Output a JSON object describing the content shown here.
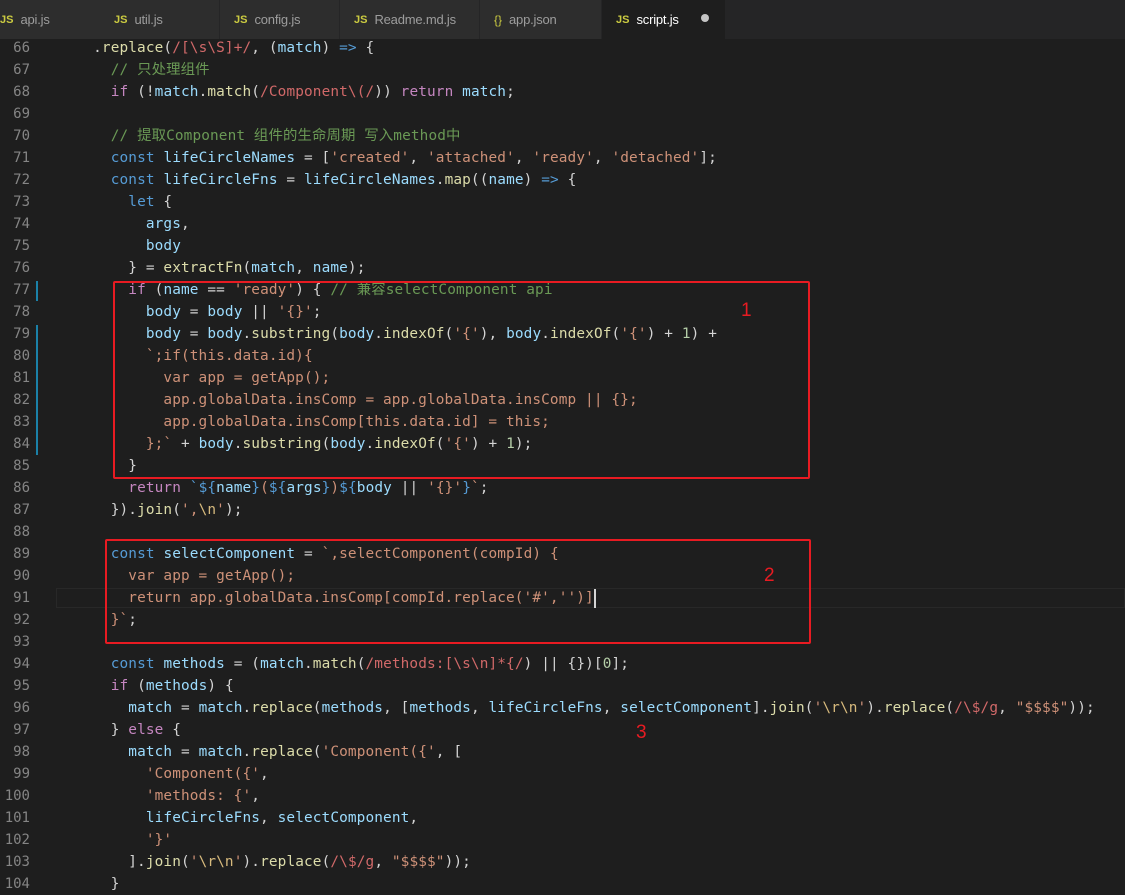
{
  "tabs": [
    {
      "icon": "JS",
      "label": "api.js",
      "active": false
    },
    {
      "icon": "JS",
      "label": "util.js",
      "active": false
    },
    {
      "icon": "JS",
      "label": "config.js",
      "active": false
    },
    {
      "icon": "JS",
      "label": "Readme.md.js",
      "active": false
    },
    {
      "icon": "{}",
      "label": "app.json",
      "active": false
    },
    {
      "icon": "JS",
      "label": "script.js",
      "active": true,
      "dirty": true
    }
  ],
  "lines": [
    {
      "n": "66"
    },
    {
      "n": "67"
    },
    {
      "n": "68"
    },
    {
      "n": "69"
    },
    {
      "n": "70"
    },
    {
      "n": "71"
    },
    {
      "n": "72"
    },
    {
      "n": "73"
    },
    {
      "n": "74"
    },
    {
      "n": "75"
    },
    {
      "n": "76"
    },
    {
      "n": "77"
    },
    {
      "n": "78"
    },
    {
      "n": "79"
    },
    {
      "n": "80"
    },
    {
      "n": "81"
    },
    {
      "n": "82"
    },
    {
      "n": "83"
    },
    {
      "n": "84"
    },
    {
      "n": "85"
    },
    {
      "n": "86"
    },
    {
      "n": "87"
    },
    {
      "n": "88"
    },
    {
      "n": "89"
    },
    {
      "n": "90"
    },
    {
      "n": "91"
    },
    {
      "n": "92"
    },
    {
      "n": "93"
    },
    {
      "n": "94"
    },
    {
      "n": "95"
    },
    {
      "n": "96"
    },
    {
      "n": "97"
    },
    {
      "n": "98"
    },
    {
      "n": "99"
    },
    {
      "n": "100"
    },
    {
      "n": "101"
    },
    {
      "n": "102"
    },
    {
      "n": "103"
    },
    {
      "n": "104"
    }
  ],
  "code": [
    [
      [
        "    .",
        "p"
      ],
      [
        "replace",
        "fn"
      ],
      [
        "(",
        "p"
      ],
      [
        "/[\\s\\S]+/",
        "rx"
      ],
      [
        ", (",
        "p"
      ],
      [
        "match",
        "var"
      ],
      [
        ") ",
        "p"
      ],
      [
        "=>",
        "kw"
      ],
      [
        " {",
        "p"
      ]
    ],
    [
      [
        "      ",
        "p"
      ],
      [
        "// 只处理组件",
        "com"
      ]
    ],
    [
      [
        "      ",
        "p"
      ],
      [
        "if",
        "ctl"
      ],
      [
        " (!",
        "p"
      ],
      [
        "match",
        "var"
      ],
      [
        ".",
        "p"
      ],
      [
        "match",
        "fn"
      ],
      [
        "(",
        "p"
      ],
      [
        "/Component\\(/",
        "rx"
      ],
      [
        ")) ",
        "p"
      ],
      [
        "return",
        "ctl"
      ],
      [
        " ",
        "p"
      ],
      [
        "match",
        "var"
      ],
      [
        ";",
        "p"
      ]
    ],
    [
      [
        "",
        "p"
      ]
    ],
    [
      [
        "      ",
        "p"
      ],
      [
        "// 提取Component 组件的生命周期 写入method中",
        "com"
      ]
    ],
    [
      [
        "      ",
        "p"
      ],
      [
        "const",
        "kw"
      ],
      [
        " ",
        "p"
      ],
      [
        "lifeCircleNames",
        "var"
      ],
      [
        " = [",
        "p"
      ],
      [
        "'created'",
        "str"
      ],
      [
        ", ",
        "p"
      ],
      [
        "'attached'",
        "str"
      ],
      [
        ", ",
        "p"
      ],
      [
        "'ready'",
        "str"
      ],
      [
        ", ",
        "p"
      ],
      [
        "'detached'",
        "str"
      ],
      [
        "];",
        "p"
      ]
    ],
    [
      [
        "      ",
        "p"
      ],
      [
        "const",
        "kw"
      ],
      [
        " ",
        "p"
      ],
      [
        "lifeCircleFns",
        "var"
      ],
      [
        " = ",
        "p"
      ],
      [
        "lifeCircleNames",
        "var"
      ],
      [
        ".",
        "p"
      ],
      [
        "map",
        "fn"
      ],
      [
        "((",
        "p"
      ],
      [
        "name",
        "var"
      ],
      [
        ") ",
        "p"
      ],
      [
        "=>",
        "kw"
      ],
      [
        " {",
        "p"
      ]
    ],
    [
      [
        "        ",
        "p"
      ],
      [
        "let",
        "kw"
      ],
      [
        " {",
        "p"
      ]
    ],
    [
      [
        "          ",
        "p"
      ],
      [
        "args",
        "var"
      ],
      [
        ",",
        "p"
      ]
    ],
    [
      [
        "          ",
        "p"
      ],
      [
        "body",
        "var"
      ]
    ],
    [
      [
        "        } = ",
        "p"
      ],
      [
        "extractFn",
        "fn"
      ],
      [
        "(",
        "p"
      ],
      [
        "match",
        "var"
      ],
      [
        ", ",
        "p"
      ],
      [
        "name",
        "var"
      ],
      [
        ");",
        "p"
      ]
    ],
    [
      [
        "        ",
        "p"
      ],
      [
        "if",
        "ctl"
      ],
      [
        " (",
        "p"
      ],
      [
        "name",
        "var"
      ],
      [
        " == ",
        "p"
      ],
      [
        "'ready'",
        "str"
      ],
      [
        ") { ",
        "p"
      ],
      [
        "// 兼容selectComponent api",
        "com"
      ]
    ],
    [
      [
        "          ",
        "p"
      ],
      [
        "body",
        "var"
      ],
      [
        " = ",
        "p"
      ],
      [
        "body",
        "var"
      ],
      [
        " || ",
        "p"
      ],
      [
        "'{}'",
        "str"
      ],
      [
        ";",
        "p"
      ]
    ],
    [
      [
        "          ",
        "p"
      ],
      [
        "body",
        "var"
      ],
      [
        " = ",
        "p"
      ],
      [
        "body",
        "var"
      ],
      [
        ".",
        "p"
      ],
      [
        "substring",
        "fn"
      ],
      [
        "(",
        "p"
      ],
      [
        "body",
        "var"
      ],
      [
        ".",
        "p"
      ],
      [
        "indexOf",
        "fn"
      ],
      [
        "(",
        "p"
      ],
      [
        "'{'",
        "str"
      ],
      [
        "), ",
        "p"
      ],
      [
        "body",
        "var"
      ],
      [
        ".",
        "p"
      ],
      [
        "indexOf",
        "fn"
      ],
      [
        "(",
        "p"
      ],
      [
        "'{'",
        "str"
      ],
      [
        ") + ",
        "p"
      ],
      [
        "1",
        "num"
      ],
      [
        ") +",
        "p"
      ]
    ],
    [
      [
        "          ",
        "p"
      ],
      [
        "`;if(this.data.id){",
        "str"
      ]
    ],
    [
      [
        "            ",
        "p"
      ],
      [
        "var app = getApp();",
        "str"
      ]
    ],
    [
      [
        "            ",
        "p"
      ],
      [
        "app.globalData.insComp = app.globalData.insComp || {};",
        "str"
      ]
    ],
    [
      [
        "            ",
        "p"
      ],
      [
        "app.globalData.insComp[this.data.id] = this;",
        "str"
      ]
    ],
    [
      [
        "          ",
        "p"
      ],
      [
        "};`",
        "str"
      ],
      [
        " + ",
        "p"
      ],
      [
        "body",
        "var"
      ],
      [
        ".",
        "p"
      ],
      [
        "substring",
        "fn"
      ],
      [
        "(",
        "p"
      ],
      [
        "body",
        "var"
      ],
      [
        ".",
        "p"
      ],
      [
        "indexOf",
        "fn"
      ],
      [
        "(",
        "p"
      ],
      [
        "'{'",
        "str"
      ],
      [
        ") + ",
        "p"
      ],
      [
        "1",
        "num"
      ],
      [
        ");",
        "p"
      ]
    ],
    [
      [
        "        }",
        "p"
      ]
    ],
    [
      [
        "        ",
        "p"
      ],
      [
        "return",
        "ctl"
      ],
      [
        " ",
        "p"
      ],
      [
        "`${",
        "kw"
      ],
      [
        "name",
        "var"
      ],
      [
        "}",
        "kw"
      ],
      [
        "(",
        "str"
      ],
      [
        "${",
        "kw"
      ],
      [
        "args",
        "var"
      ],
      [
        "}",
        "kw"
      ],
      [
        ")",
        "str"
      ],
      [
        "${",
        "kw"
      ],
      [
        "body",
        "var"
      ],
      [
        " || ",
        "p"
      ],
      [
        "'{}'",
        "str"
      ],
      [
        "}",
        "kw"
      ],
      [
        "`",
        "str"
      ],
      [
        ";",
        "p"
      ]
    ],
    [
      [
        "      }).",
        "p"
      ],
      [
        "join",
        "fn"
      ],
      [
        "(",
        "p"
      ],
      [
        "',",
        "str"
      ],
      [
        "\\n",
        "esc"
      ],
      [
        "'",
        "str"
      ],
      [
        ");",
        "p"
      ]
    ],
    [
      [
        "",
        "p"
      ]
    ],
    [
      [
        "      ",
        "p"
      ],
      [
        "const",
        "kw"
      ],
      [
        " ",
        "p"
      ],
      [
        "selectComponent",
        "var"
      ],
      [
        " = ",
        "p"
      ],
      [
        "`,selectComponent(compId) {",
        "str"
      ]
    ],
    [
      [
        "        ",
        "p"
      ],
      [
        "var app = getApp();",
        "str"
      ]
    ],
    [
      [
        "        ",
        "p"
      ],
      [
        "return app.globalData.insComp[compId.replace('#','')]",
        "str"
      ]
    ],
    [
      [
        "      ",
        "p"
      ],
      [
        "}`",
        "str"
      ],
      [
        ";",
        "p"
      ]
    ],
    [
      [
        "",
        "p"
      ]
    ],
    [
      [
        "      ",
        "p"
      ],
      [
        "const",
        "kw"
      ],
      [
        " ",
        "p"
      ],
      [
        "methods",
        "var"
      ],
      [
        " = (",
        "p"
      ],
      [
        "match",
        "var"
      ],
      [
        ".",
        "p"
      ],
      [
        "match",
        "fn"
      ],
      [
        "(",
        "p"
      ],
      [
        "/methods:[\\s\\n]*{/",
        "rx"
      ],
      [
        ") || {})[",
        "p"
      ],
      [
        "0",
        "num"
      ],
      [
        "];",
        "p"
      ]
    ],
    [
      [
        "      ",
        "p"
      ],
      [
        "if",
        "ctl"
      ],
      [
        " (",
        "p"
      ],
      [
        "methods",
        "var"
      ],
      [
        ") {",
        "p"
      ]
    ],
    [
      [
        "        ",
        "p"
      ],
      [
        "match",
        "var"
      ],
      [
        " = ",
        "p"
      ],
      [
        "match",
        "var"
      ],
      [
        ".",
        "p"
      ],
      [
        "replace",
        "fn"
      ],
      [
        "(",
        "p"
      ],
      [
        "methods",
        "var"
      ],
      [
        ", [",
        "p"
      ],
      [
        "methods",
        "var"
      ],
      [
        ", ",
        "p"
      ],
      [
        "lifeCircleFns",
        "var"
      ],
      [
        ", ",
        "p"
      ],
      [
        "selectComponent",
        "var"
      ],
      [
        "].",
        "p"
      ],
      [
        "join",
        "fn"
      ],
      [
        "(",
        "p"
      ],
      [
        "'",
        "str"
      ],
      [
        "\\r\\n",
        "esc"
      ],
      [
        "'",
        "str"
      ],
      [
        ").",
        "p"
      ],
      [
        "replace",
        "fn"
      ],
      [
        "(",
        "p"
      ],
      [
        "/\\$/g",
        "rx"
      ],
      [
        ", ",
        "p"
      ],
      [
        "\"$$$$\"",
        "str"
      ],
      [
        "));",
        "p"
      ]
    ],
    [
      [
        "      } ",
        "p"
      ],
      [
        "else",
        "ctl"
      ],
      [
        " {",
        "p"
      ]
    ],
    [
      [
        "        ",
        "p"
      ],
      [
        "match",
        "var"
      ],
      [
        " = ",
        "p"
      ],
      [
        "match",
        "var"
      ],
      [
        ".",
        "p"
      ],
      [
        "replace",
        "fn"
      ],
      [
        "(",
        "p"
      ],
      [
        "'Component({'",
        "str"
      ],
      [
        ", [",
        "p"
      ]
    ],
    [
      [
        "          ",
        "p"
      ],
      [
        "'Component({'",
        "str"
      ],
      [
        ",",
        "p"
      ]
    ],
    [
      [
        "          ",
        "p"
      ],
      [
        "'methods: {'",
        "str"
      ],
      [
        ",",
        "p"
      ]
    ],
    [
      [
        "          ",
        "p"
      ],
      [
        "lifeCircleFns",
        "var"
      ],
      [
        ", ",
        "p"
      ],
      [
        "selectComponent",
        "var"
      ],
      [
        ",",
        "p"
      ]
    ],
    [
      [
        "          ",
        "p"
      ],
      [
        "'}'",
        "str"
      ]
    ],
    [
      [
        "        ].",
        "p"
      ],
      [
        "join",
        "fn"
      ],
      [
        "(",
        "p"
      ],
      [
        "'",
        "str"
      ],
      [
        "\\r\\n",
        "esc"
      ],
      [
        "'",
        "str"
      ],
      [
        ").",
        "p"
      ],
      [
        "replace",
        "fn"
      ],
      [
        "(",
        "p"
      ],
      [
        "/\\$/g",
        "rx"
      ],
      [
        ", ",
        "p"
      ],
      [
        "\"$$$$\"",
        "str"
      ],
      [
        "));",
        "p"
      ]
    ],
    [
      [
        "      }",
        "p"
      ]
    ]
  ],
  "annotations": [
    {
      "label": "1"
    },
    {
      "label": "2"
    },
    {
      "label": "3"
    }
  ],
  "colors": {
    "background": "#1e1e1e",
    "annotation": "#e81b22",
    "gutter_change": "#1b81a8"
  }
}
